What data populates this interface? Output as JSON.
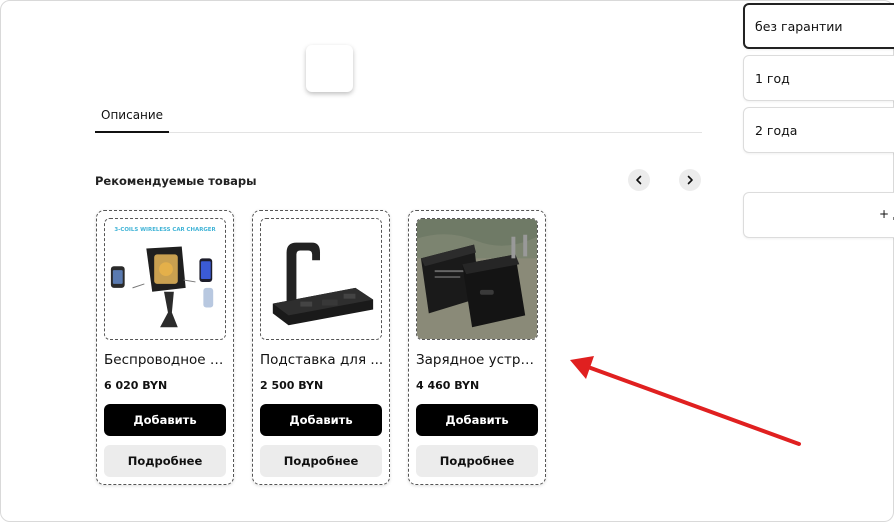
{
  "tabs": {
    "description": "Описание"
  },
  "recommended": {
    "title": "Рекомендуемые товары",
    "products": [
      {
        "name": "Беспроводное з...",
        "price": "6 020 BYN",
        "image_label": "3-COILS WIRELESS CAR CHARGER",
        "add_label": "Добавить",
        "more_label": "Подробнее"
      },
      {
        "name": "Подставка для ...",
        "price": "2 500 BYN",
        "add_label": "Добавить",
        "more_label": "Подробнее"
      },
      {
        "name": "Зарядное устро...",
        "price": "4 460 BYN",
        "add_label": "Добавить",
        "more_label": "Подробнее"
      }
    ]
  },
  "warranty": {
    "options": [
      "без гарантии",
      "1 год",
      "2 года"
    ],
    "selected": "без гарантии",
    "more_label": "+ Д"
  },
  "colors": {
    "arrow": "#e02020",
    "button_dark": "#000000",
    "button_light": "#ececec"
  },
  "icons": {
    "prev": "chevron-left-icon",
    "next": "chevron-right-icon"
  }
}
